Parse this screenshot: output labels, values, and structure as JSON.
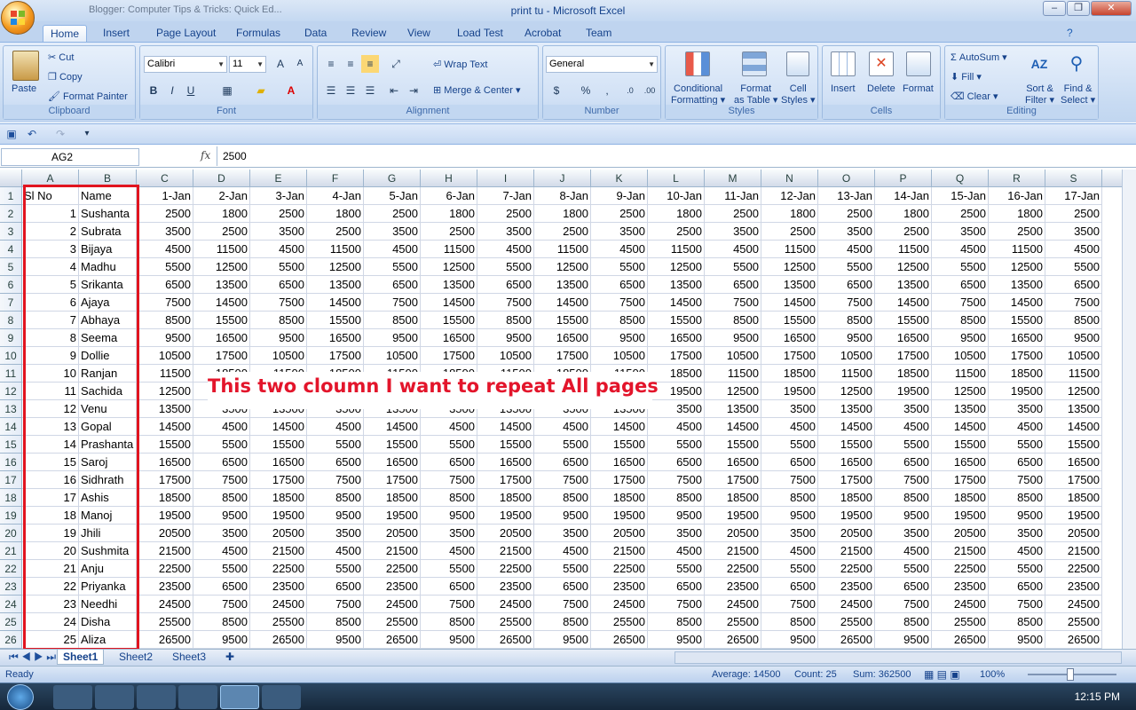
{
  "window": {
    "title": "print tu - Microsoft Excel",
    "background_title": "Blogger: Computer Tips & Tricks: Quick Ed..."
  },
  "tabs": [
    "Home",
    "Insert",
    "Page Layout",
    "Formulas",
    "Data",
    "Review",
    "View",
    "Load Test",
    "Acrobat",
    "Team"
  ],
  "ribbon": {
    "clipboard": {
      "label": "Clipboard",
      "paste": "Paste",
      "cut": "Cut",
      "copy": "Copy",
      "format_painter": "Format Painter"
    },
    "font": {
      "label": "Font",
      "name": "Calibri",
      "size": "11"
    },
    "alignment": {
      "label": "Alignment",
      "wrap": "Wrap Text",
      "merge": "Merge & Center"
    },
    "number": {
      "label": "Number",
      "format": "General"
    },
    "styles": {
      "label": "Styles",
      "cond1": "Conditional",
      "cond2": "Formatting",
      "fmt1": "Format",
      "fmt2": "as Table",
      "cell1": "Cell",
      "cell2": "Styles"
    },
    "cells": {
      "label": "Cells",
      "insert": "Insert",
      "delete": "Delete",
      "format": "Format"
    },
    "editing": {
      "label": "Editing",
      "autosum": "AutoSum",
      "fill": "Fill",
      "clear": "Clear",
      "sort1": "Sort &",
      "sort2": "Filter",
      "find1": "Find &",
      "find2": "Select"
    }
  },
  "formula_bar": {
    "name_box": "AG2",
    "fx": "fx",
    "value": "2500"
  },
  "columns": [
    "A",
    "B",
    "C",
    "D",
    "E",
    "F",
    "G",
    "H",
    "I",
    "J",
    "K",
    "L",
    "M",
    "N",
    "O",
    "P",
    "Q",
    "R",
    "S"
  ],
  "header_row": [
    "Sl No",
    "Name",
    "1-Jan",
    "2-Jan",
    "3-Jan",
    "4-Jan",
    "5-Jan",
    "6-Jan",
    "7-Jan",
    "8-Jan",
    "9-Jan",
    "10-Jan",
    "11-Jan",
    "12-Jan",
    "13-Jan",
    "14-Jan",
    "15-Jan",
    "16-Jan",
    "17-Jan"
  ],
  "rows": [
    [
      "1",
      "Sushanta",
      "2500",
      "1800",
      "2500",
      "1800",
      "2500",
      "1800",
      "2500",
      "1800",
      "2500",
      "1800",
      "2500",
      "1800",
      "2500",
      "1800",
      "2500",
      "1800",
      "2500"
    ],
    [
      "2",
      "Subrata",
      "3500",
      "2500",
      "3500",
      "2500",
      "3500",
      "2500",
      "3500",
      "2500",
      "3500",
      "2500",
      "3500",
      "2500",
      "3500",
      "2500",
      "3500",
      "2500",
      "3500"
    ],
    [
      "3",
      "Bijaya",
      "4500",
      "11500",
      "4500",
      "11500",
      "4500",
      "11500",
      "4500",
      "11500",
      "4500",
      "11500",
      "4500",
      "11500",
      "4500",
      "11500",
      "4500",
      "11500",
      "4500"
    ],
    [
      "4",
      "Madhu",
      "5500",
      "12500",
      "5500",
      "12500",
      "5500",
      "12500",
      "5500",
      "12500",
      "5500",
      "12500",
      "5500",
      "12500",
      "5500",
      "12500",
      "5500",
      "12500",
      "5500"
    ],
    [
      "5",
      "Srikanta",
      "6500",
      "13500",
      "6500",
      "13500",
      "6500",
      "13500",
      "6500",
      "13500",
      "6500",
      "13500",
      "6500",
      "13500",
      "6500",
      "13500",
      "6500",
      "13500",
      "6500"
    ],
    [
      "6",
      "Ajaya",
      "7500",
      "14500",
      "7500",
      "14500",
      "7500",
      "14500",
      "7500",
      "14500",
      "7500",
      "14500",
      "7500",
      "14500",
      "7500",
      "14500",
      "7500",
      "14500",
      "7500"
    ],
    [
      "7",
      "Abhaya",
      "8500",
      "15500",
      "8500",
      "15500",
      "8500",
      "15500",
      "8500",
      "15500",
      "8500",
      "15500",
      "8500",
      "15500",
      "8500",
      "15500",
      "8500",
      "15500",
      "8500"
    ],
    [
      "8",
      "Seema",
      "9500",
      "16500",
      "9500",
      "16500",
      "9500",
      "16500",
      "9500",
      "16500",
      "9500",
      "16500",
      "9500",
      "16500",
      "9500",
      "16500",
      "9500",
      "16500",
      "9500"
    ],
    [
      "9",
      "Dollie",
      "10500",
      "17500",
      "10500",
      "17500",
      "10500",
      "17500",
      "10500",
      "17500",
      "10500",
      "17500",
      "10500",
      "17500",
      "10500",
      "17500",
      "10500",
      "17500",
      "10500"
    ],
    [
      "10",
      "Ranjan",
      "11500",
      "18500",
      "11500",
      "18500",
      "11500",
      "18500",
      "11500",
      "18500",
      "11500",
      "18500",
      "11500",
      "18500",
      "11500",
      "18500",
      "11500",
      "18500",
      "11500"
    ],
    [
      "11",
      "Sachida",
      "12500",
      "19500",
      "12500",
      "19500",
      "12500",
      "19500",
      "12500",
      "19500",
      "12500",
      "19500",
      "12500",
      "19500",
      "12500",
      "19500",
      "12500",
      "19500",
      "12500"
    ],
    [
      "12",
      "Venu",
      "13500",
      "3500",
      "13500",
      "3500",
      "13500",
      "3500",
      "13500",
      "3500",
      "13500",
      "3500",
      "13500",
      "3500",
      "13500",
      "3500",
      "13500",
      "3500",
      "13500"
    ],
    [
      "13",
      "Gopal",
      "14500",
      "4500",
      "14500",
      "4500",
      "14500",
      "4500",
      "14500",
      "4500",
      "14500",
      "4500",
      "14500",
      "4500",
      "14500",
      "4500",
      "14500",
      "4500",
      "14500"
    ],
    [
      "14",
      "Prashanta",
      "15500",
      "5500",
      "15500",
      "5500",
      "15500",
      "5500",
      "15500",
      "5500",
      "15500",
      "5500",
      "15500",
      "5500",
      "15500",
      "5500",
      "15500",
      "5500",
      "15500"
    ],
    [
      "15",
      "Saroj",
      "16500",
      "6500",
      "16500",
      "6500",
      "16500",
      "6500",
      "16500",
      "6500",
      "16500",
      "6500",
      "16500",
      "6500",
      "16500",
      "6500",
      "16500",
      "6500",
      "16500"
    ],
    [
      "16",
      "Sidhrath",
      "17500",
      "7500",
      "17500",
      "7500",
      "17500",
      "7500",
      "17500",
      "7500",
      "17500",
      "7500",
      "17500",
      "7500",
      "17500",
      "7500",
      "17500",
      "7500",
      "17500"
    ],
    [
      "17",
      "Ashis",
      "18500",
      "8500",
      "18500",
      "8500",
      "18500",
      "8500",
      "18500",
      "8500",
      "18500",
      "8500",
      "18500",
      "8500",
      "18500",
      "8500",
      "18500",
      "8500",
      "18500"
    ],
    [
      "18",
      "Manoj",
      "19500",
      "9500",
      "19500",
      "9500",
      "19500",
      "9500",
      "19500",
      "9500",
      "19500",
      "9500",
      "19500",
      "9500",
      "19500",
      "9500",
      "19500",
      "9500",
      "19500"
    ],
    [
      "19",
      "Jhili",
      "20500",
      "3500",
      "20500",
      "3500",
      "20500",
      "3500",
      "20500",
      "3500",
      "20500",
      "3500",
      "20500",
      "3500",
      "20500",
      "3500",
      "20500",
      "3500",
      "20500"
    ],
    [
      "20",
      "Sushmita",
      "21500",
      "4500",
      "21500",
      "4500",
      "21500",
      "4500",
      "21500",
      "4500",
      "21500",
      "4500",
      "21500",
      "4500",
      "21500",
      "4500",
      "21500",
      "4500",
      "21500"
    ],
    [
      "21",
      "Anju",
      "22500",
      "5500",
      "22500",
      "5500",
      "22500",
      "5500",
      "22500",
      "5500",
      "22500",
      "5500",
      "22500",
      "5500",
      "22500",
      "5500",
      "22500",
      "5500",
      "22500"
    ],
    [
      "22",
      "Priyanka",
      "23500",
      "6500",
      "23500",
      "6500",
      "23500",
      "6500",
      "23500",
      "6500",
      "23500",
      "6500",
      "23500",
      "6500",
      "23500",
      "6500",
      "23500",
      "6500",
      "23500"
    ],
    [
      "23",
      "Needhi",
      "24500",
      "7500",
      "24500",
      "7500",
      "24500",
      "7500",
      "24500",
      "7500",
      "24500",
      "7500",
      "24500",
      "7500",
      "24500",
      "7500",
      "24500",
      "7500",
      "24500"
    ],
    [
      "24",
      "Disha",
      "25500",
      "8500",
      "25500",
      "8500",
      "25500",
      "8500",
      "25500",
      "8500",
      "25500",
      "8500",
      "25500",
      "8500",
      "25500",
      "8500",
      "25500",
      "8500",
      "25500"
    ],
    [
      "25",
      "Aliza",
      "26500",
      "9500",
      "26500",
      "9500",
      "26500",
      "9500",
      "26500",
      "9500",
      "26500",
      "9500",
      "26500",
      "9500",
      "26500",
      "9500",
      "26500",
      "9500",
      "26500"
    ]
  ],
  "annotation": "This two cloumn I want to repeat All pages",
  "sheets": [
    "Sheet1",
    "Sheet2",
    "Sheet3"
  ],
  "status": {
    "ready": "Ready",
    "average": "Average: 14500",
    "count": "Count: 25",
    "sum": "Sum: 362500",
    "zoom": "100%"
  },
  "clock": "12:15 PM",
  "colors": {
    "annotation": "#e3152b",
    "ribbon": "#c8dbf2"
  }
}
